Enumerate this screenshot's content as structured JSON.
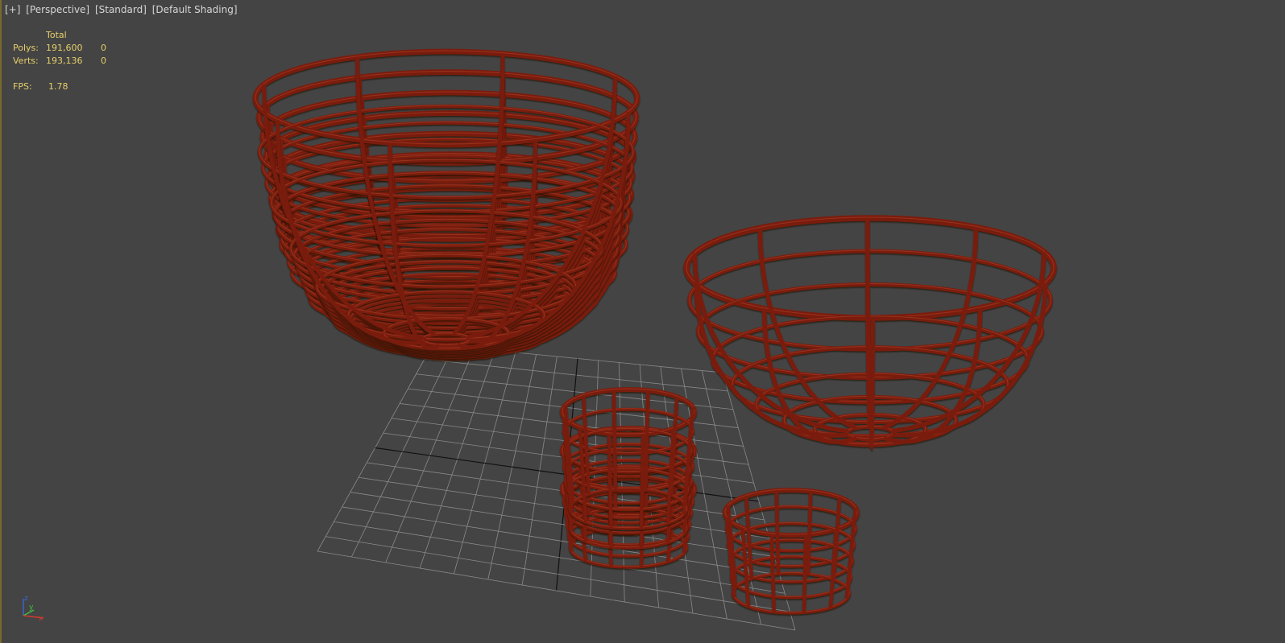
{
  "viewport": {
    "menu": [
      "[+]",
      "[Perspective]",
      "[Standard]",
      "[Default Shading]"
    ]
  },
  "stats": {
    "header": "Total",
    "polys_label": "Polys:",
    "polys_total": "191,600",
    "polys_selected": "0",
    "verts_label": "Verts:",
    "verts_total": "193,136",
    "verts_selected": "0",
    "fps_label": "FPS:",
    "fps_value": "1.78"
  },
  "gizmo": {
    "z": "z",
    "y": "y",
    "x": "x"
  },
  "colors": {
    "background": "#444444",
    "grid": "#8a8a8a",
    "wire": "#7a1e10",
    "wire_highlight": "#b0442c",
    "stats_text": "#e6cf6a"
  },
  "scene_objects": [
    "large-bowl-stack",
    "large-wire-bowl",
    "small-cup-stack",
    "small-wire-cup"
  ]
}
